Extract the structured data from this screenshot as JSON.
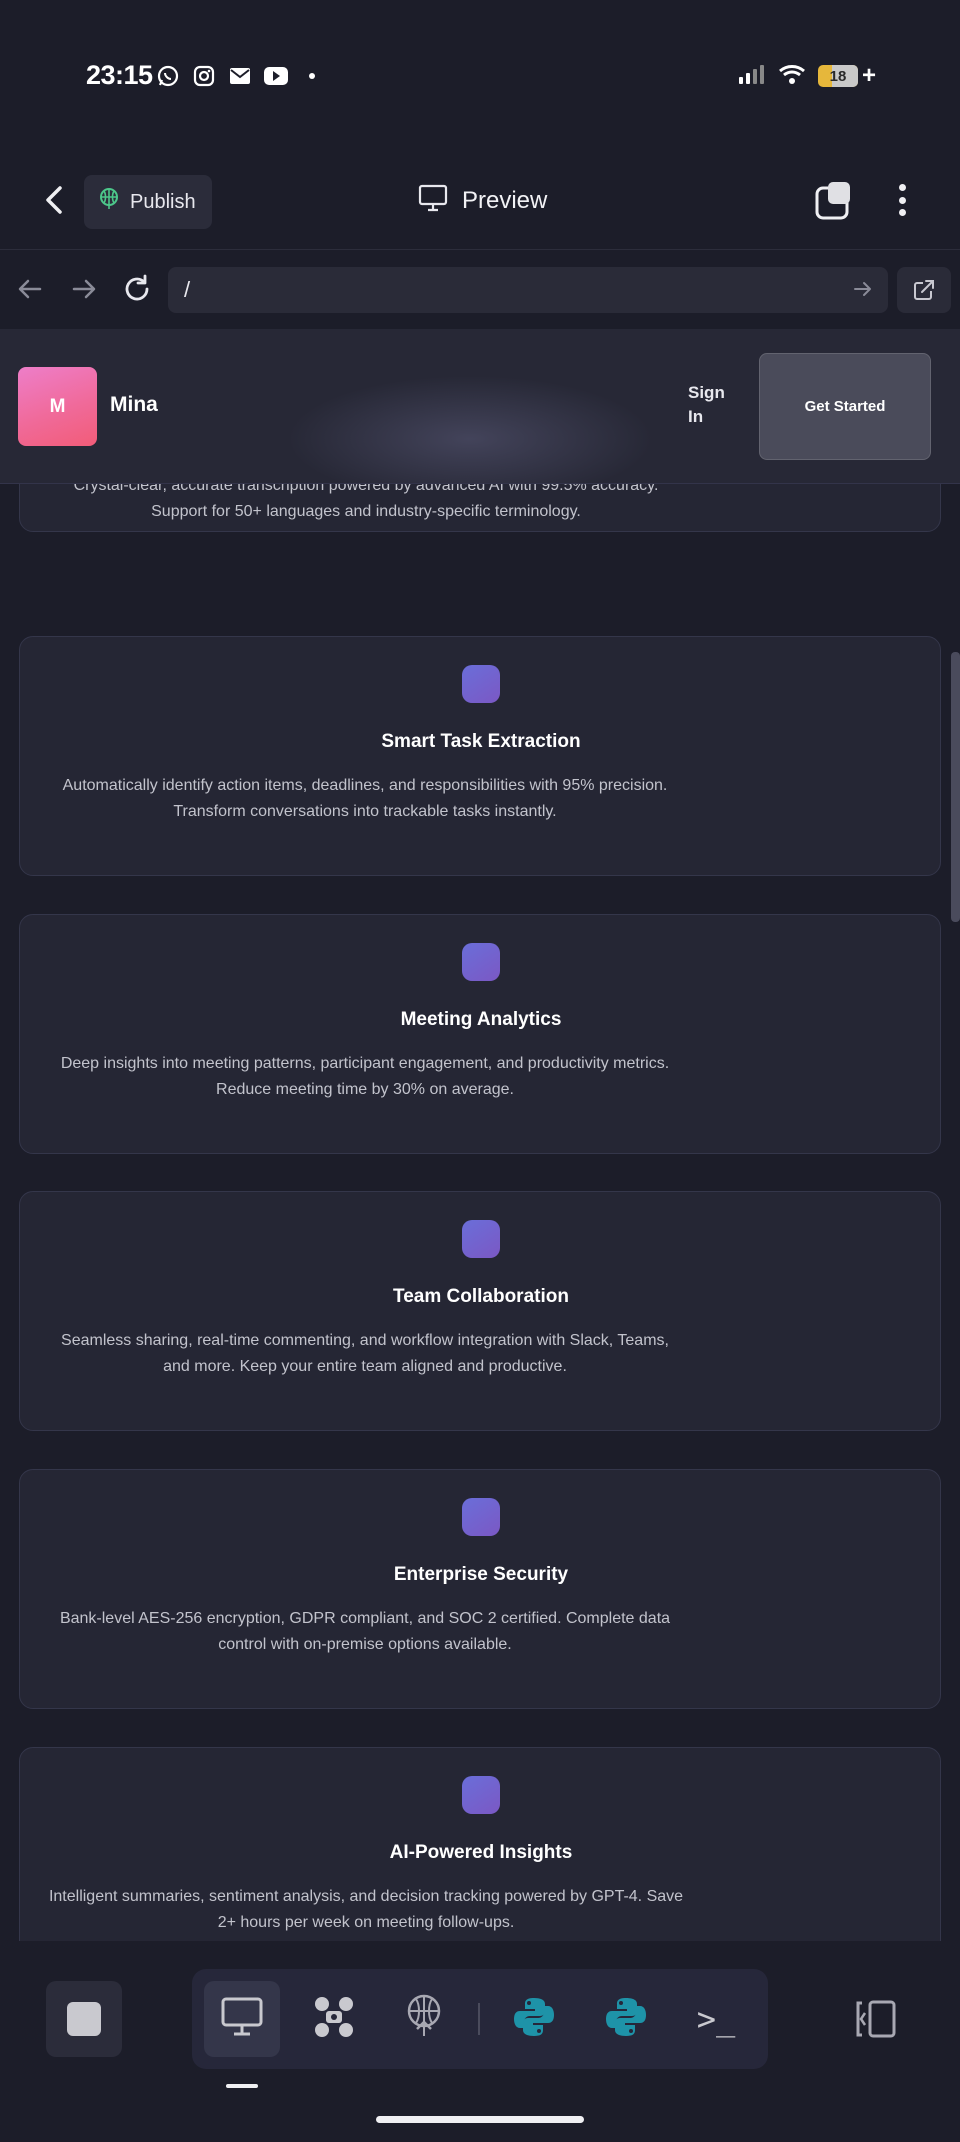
{
  "status_bar": {
    "time": "23:15",
    "battery": "18",
    "icons": [
      "whatsapp-icon",
      "instagram-icon",
      "mail-icon",
      "youtube-icon",
      "dot-icon",
      "signal-icon",
      "wifi-icon",
      "battery-icon"
    ]
  },
  "header": {
    "publish_label": "Publish",
    "preview_label": "Preview"
  },
  "browser": {
    "url": "/"
  },
  "site": {
    "logo_letter": "M",
    "brand_name": "Mina",
    "sign_in": "Sign In",
    "get_started": "Get Started"
  },
  "features": [
    {
      "title": "",
      "description": "Crystal-clear, accurate transcription powered by advanced AI with 99.5% accuracy. Support for 50+ languages and industry-specific terminology."
    },
    {
      "title": "Smart Task Extraction",
      "description": "Automatically identify action items, deadlines, and responsibilities with 95% precision. Transform conversations into trackable tasks instantly."
    },
    {
      "title": "Meeting Analytics",
      "description": "Deep insights into meeting patterns, participant engagement, and productivity metrics. Reduce meeting time by 30% on average."
    },
    {
      "title": "Team Collaboration",
      "description": "Seamless sharing, real-time commenting, and workflow integration with Slack, Teams, and more. Keep your entire team aligned and productive."
    },
    {
      "title": "Enterprise Security",
      "description": "Bank-level AES-256 encryption, GDPR compliant, and SOC 2 certified. Complete data control with on-premise options available."
    },
    {
      "title": "AI-Powered Insights",
      "description": "Intelligent summaries, sentiment analysis, and decision tracking powered by GPT-4. Save 2+ hours per week on meeting follow-ups."
    }
  ],
  "toolbar": {
    "terminal_symbol": ">_"
  },
  "colors": {
    "background": "#1c1d29",
    "card": "#252634",
    "accent_pink": "#f06a9a",
    "feature_icon": "#6a6ed9",
    "python_teal": "#1e93a8",
    "publish_green": "#4cc78a"
  }
}
